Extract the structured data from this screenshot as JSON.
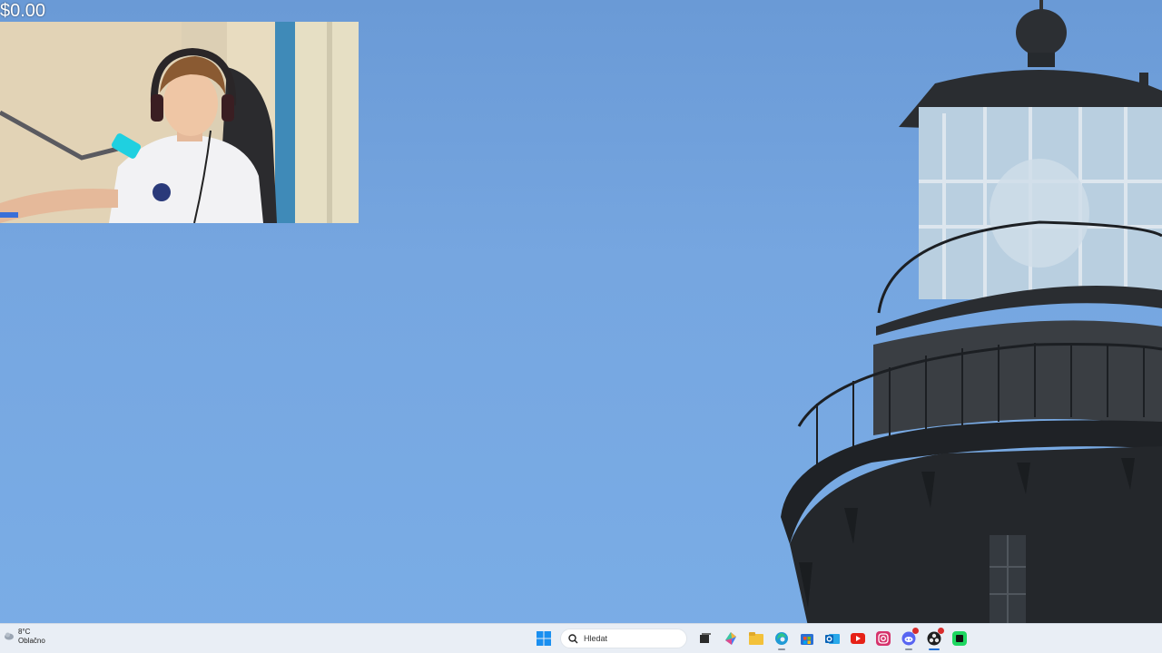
{
  "overlay": {
    "donation_amount": "$0.00"
  },
  "taskbar": {
    "weather": {
      "temperature": "8°C",
      "condition": "Oblačno"
    },
    "search": {
      "placeholder": "Hledat"
    },
    "apps": [
      {
        "name": "start-menu"
      },
      {
        "name": "task-view"
      },
      {
        "name": "copilot"
      },
      {
        "name": "file-explorer"
      },
      {
        "name": "edge"
      },
      {
        "name": "microsoft-store"
      },
      {
        "name": "outlook"
      },
      {
        "name": "youtube"
      },
      {
        "name": "instagram"
      },
      {
        "name": "discord"
      },
      {
        "name": "obs"
      },
      {
        "name": "spotify"
      }
    ]
  }
}
